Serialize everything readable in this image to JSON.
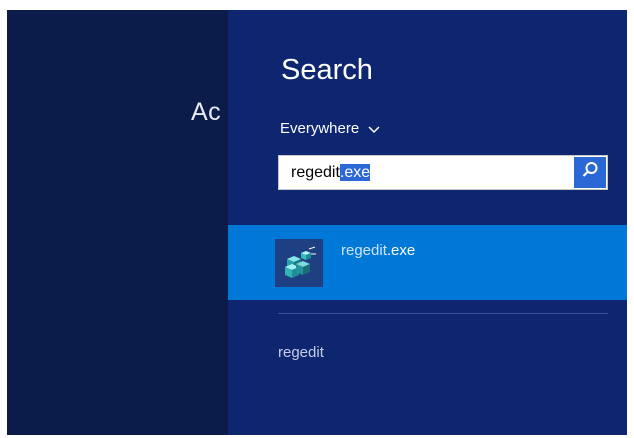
{
  "background": {
    "partial_text": "Ac"
  },
  "search_panel": {
    "title": "Search",
    "scope_label": "Everywhere",
    "query_typed": "regedit",
    "query_selected": ".exe",
    "results": [
      {
        "name_plain": "regedit",
        "name_highlight": ".exe",
        "icon": "registry-editor-icon"
      }
    ],
    "suggestions": [
      "regedit"
    ]
  },
  "colors": {
    "background": "#0b1c4a",
    "panel": "#0e2570",
    "accent": "#0078d7",
    "selection": "#2c67d6"
  }
}
